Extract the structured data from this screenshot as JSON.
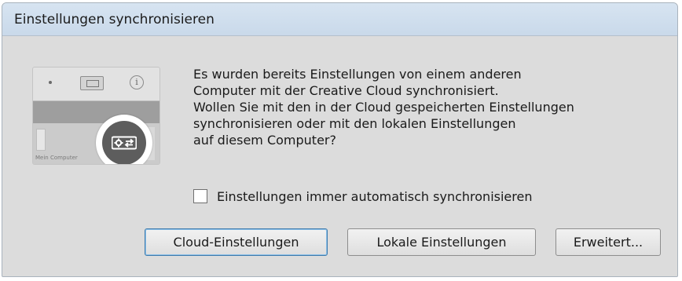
{
  "window": {
    "title": "Einstellungen synchronisieren"
  },
  "illustration": {
    "icon": "sync-settings-icon",
    "caption": "Mein Computer"
  },
  "message": {
    "lines": [
      "Es wurden bereits Einstellungen von einem anderen",
      "Computer mit der Creative Cloud synchronisiert.",
      "Wollen Sie mit den in der Cloud gespeicherten Einstellungen",
      "synchronisieren oder mit den lokalen Einstellungen",
      "auf diesem Computer?"
    ]
  },
  "checkbox": {
    "label": "Einstellungen immer automatisch synchronisieren",
    "checked": false
  },
  "buttons": {
    "cloud": "Cloud-Einstellungen",
    "local": "Lokale Einstellungen",
    "advanced": "Erweitert..."
  },
  "colors": {
    "titlebar": "#d1e0ef",
    "dialog_bg": "#dcdcdc",
    "default_button_border": "#3d7bad"
  }
}
